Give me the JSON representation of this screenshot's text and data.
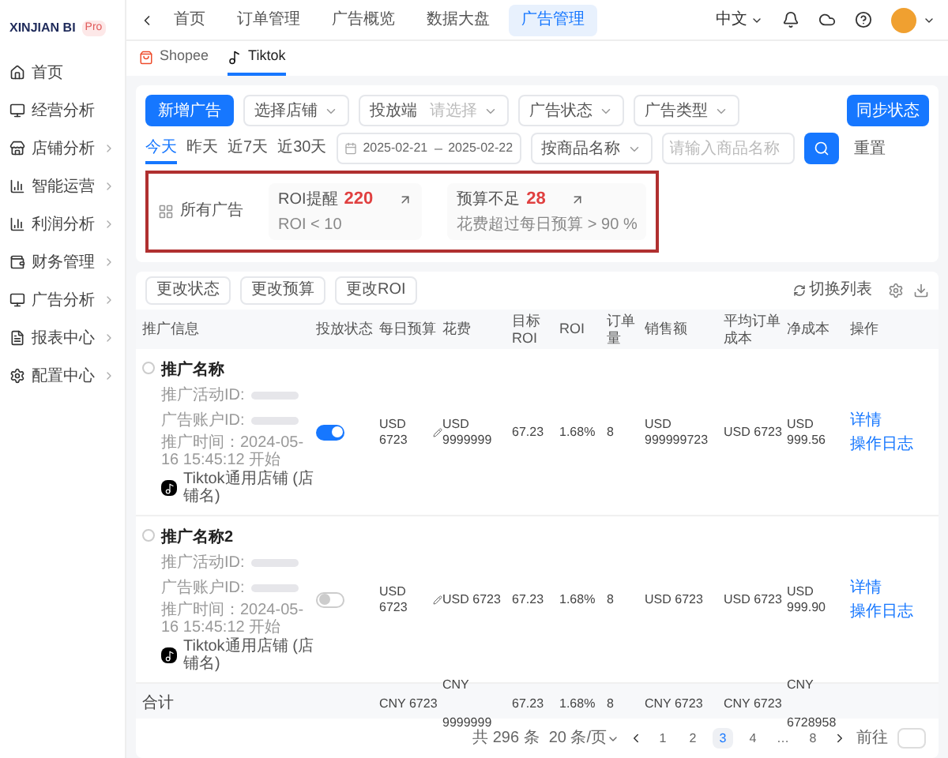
{
  "brand": {
    "name": "XINJIAN BI",
    "badge": "Pro"
  },
  "sidebar": {
    "items": [
      {
        "label": "首页",
        "expandable": false
      },
      {
        "label": "经营分析",
        "expandable": false
      },
      {
        "label": "店铺分析",
        "expandable": true
      },
      {
        "label": "智能运营",
        "expandable": true
      },
      {
        "label": "利润分析",
        "expandable": true
      },
      {
        "label": "财务管理",
        "expandable": true
      },
      {
        "label": "广告分析",
        "expandable": true
      },
      {
        "label": "报表中心",
        "expandable": true
      },
      {
        "label": "配置中心",
        "expandable": true
      }
    ]
  },
  "top_tabs": [
    {
      "label": "首页",
      "selected": false
    },
    {
      "label": "订单管理",
      "selected": false
    },
    {
      "label": "广告概览",
      "selected": false
    },
    {
      "label": "数据大盘",
      "selected": false
    },
    {
      "label": "广告管理",
      "selected": true
    }
  ],
  "header": {
    "language": "中文"
  },
  "platform_tabs": [
    {
      "label": "Shopee",
      "selected": false
    },
    {
      "label": "Tiktok",
      "selected": true
    }
  ],
  "filters": {
    "add_button": "新增广告",
    "shop_select": "选择店铺",
    "channel_select": {
      "label": "投放端",
      "placeholder": "请选择"
    },
    "status_select": "广告状态",
    "type_select": "广告类型",
    "date_ranges": [
      {
        "label": "今天",
        "selected": true
      },
      {
        "label": "昨天",
        "selected": false
      },
      {
        "label": "近7天",
        "selected": false
      },
      {
        "label": "近30天",
        "selected": false
      }
    ],
    "date_start": "2025-02-21",
    "date_end": "2025-02-22",
    "field_select": "按商品名称",
    "search_placeholder": "请输入商品名称",
    "reset_button": "重置",
    "sync_button": "同步状态"
  },
  "summary": {
    "all_label": "所有广告",
    "alerts": [
      {
        "label": "ROI提醒",
        "count": "220",
        "note": "ROI < 10"
      },
      {
        "label": "预算不足",
        "count": "28",
        "note": "花费超过每日预算 > 90 %"
      }
    ]
  },
  "actions": [
    "更改状态",
    "更改预算",
    "更改ROI"
  ],
  "switch_list": "切换列表",
  "table": {
    "columns": [
      "推广信息",
      "投放状态",
      "每日预算",
      "花费",
      "目标ROI",
      "ROI",
      "订单量",
      "销售额",
      "平均订单成本",
      "净成本",
      "操作"
    ],
    "rows": [
      {
        "name": "推广名称",
        "checked": false,
        "campaign_label": "推广活动ID:",
        "account_label": "广告账户ID:",
        "time": "推广时间：2024-05-16 15:45:12 开始",
        "shop": "Tiktok通用店铺 (店铺名)",
        "active": true,
        "budget": "USD 6723",
        "spend": "USD 9999999",
        "target_roi": "67.23",
        "roi": "1.68%",
        "orders": "8",
        "sales": "USD 999999723",
        "avg_cost": "USD 6723",
        "net_cost": "USD 999.56",
        "links": [
          "详情",
          "操作日志"
        ]
      },
      {
        "name": "推广名称2",
        "checked": false,
        "campaign_label": "推广活动ID:",
        "account_label": "广告账户ID:",
        "time": "推广时间：2024-05-16 15:45:12 开始",
        "shop": "Tiktok通用店铺 (店铺名)",
        "active": false,
        "budget": "USD 6723",
        "spend": "USD 6723",
        "target_roi": "67.23",
        "roi": "1.68%",
        "orders": "8",
        "sales": "USD 6723",
        "avg_cost": "USD 6723",
        "net_cost": "USD 999.90",
        "links": [
          "详情",
          "操作日志"
        ]
      }
    ],
    "total": {
      "label": "合计",
      "cells": [
        "CNY 6723",
        "CNY 9999999",
        "67.23",
        "1.68%",
        "8",
        "CNY 6723",
        "CNY 6723",
        "CNY 6728958"
      ]
    }
  },
  "pagination": {
    "total": "共 296 条",
    "page_size": "20 条/页",
    "pages": [
      {
        "label": "1",
        "selected": false
      },
      {
        "label": "2",
        "selected": false
      },
      {
        "label": "3",
        "selected": true
      },
      {
        "label": "4",
        "selected": false
      },
      {
        "label": "…",
        "selected": false
      },
      {
        "label": "8",
        "selected": false
      }
    ],
    "goto": "前往"
  }
}
